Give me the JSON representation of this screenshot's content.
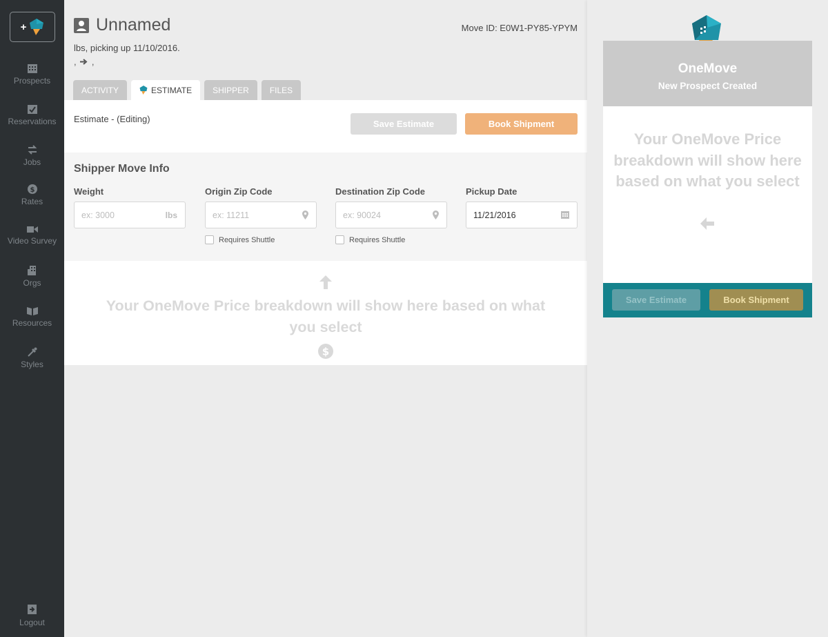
{
  "sidebar": {
    "new_button": "+",
    "items": [
      {
        "label": "Prospects",
        "icon": "grid-calendar-icon"
      },
      {
        "label": "Reservations",
        "icon": "calendar-check-icon"
      },
      {
        "label": "Jobs",
        "icon": "swap-arrows-icon"
      },
      {
        "label": "Rates",
        "icon": "dollar-circle-icon"
      },
      {
        "label": "Video Survey",
        "icon": "video-camera-icon"
      },
      {
        "label": "Orgs",
        "icon": "building-icon"
      },
      {
        "label": "Resources",
        "icon": "book-icon"
      },
      {
        "label": "Styles",
        "icon": "pipette-icon"
      }
    ],
    "logout": "Logout"
  },
  "header": {
    "title": "Unnamed",
    "move_id": "Move ID: E0W1-PY85-YPYM",
    "subline": "lbs, picking up 11/10/2016.",
    "route_left": ",",
    "route_right": ","
  },
  "tabs": [
    {
      "label": "ACTIVITY",
      "active": false
    },
    {
      "label": "ESTIMATE",
      "active": true
    },
    {
      "label": "SHIPPER",
      "active": false
    },
    {
      "label": "FILES",
      "active": false
    }
  ],
  "estimate": {
    "label": "Estimate - (Editing)",
    "save_label": "Save Estimate",
    "book_label": "Book Shipment"
  },
  "shipper": {
    "heading": "Shipper Move Info",
    "weight": {
      "label": "Weight",
      "placeholder": "ex: 3000",
      "suffix": "lbs"
    },
    "origin": {
      "label": "Origin Zip Code",
      "placeholder": "ex: 11211",
      "shuttle": "Requires Shuttle"
    },
    "destination": {
      "label": "Destination Zip Code",
      "placeholder": "ex: 90024",
      "shuttle": "Requires Shuttle"
    },
    "pickup": {
      "label": "Pickup Date",
      "value": "11/21/2016"
    }
  },
  "breakdown": {
    "message": "Your OneMove Price breakdown will show here based on what you select"
  },
  "panel": {
    "brand": "OneMove",
    "status": "New Prospect Created",
    "message": "Your OneMove Price breakdown will show here based on what you select",
    "save_label": "Save Estimate",
    "book_label": "Book Shipment"
  },
  "colors": {
    "sidebar": "#2c3033",
    "accent_orange": "#f0b27a",
    "teal": "#14828c",
    "logo_blue": "#1f93a8"
  }
}
